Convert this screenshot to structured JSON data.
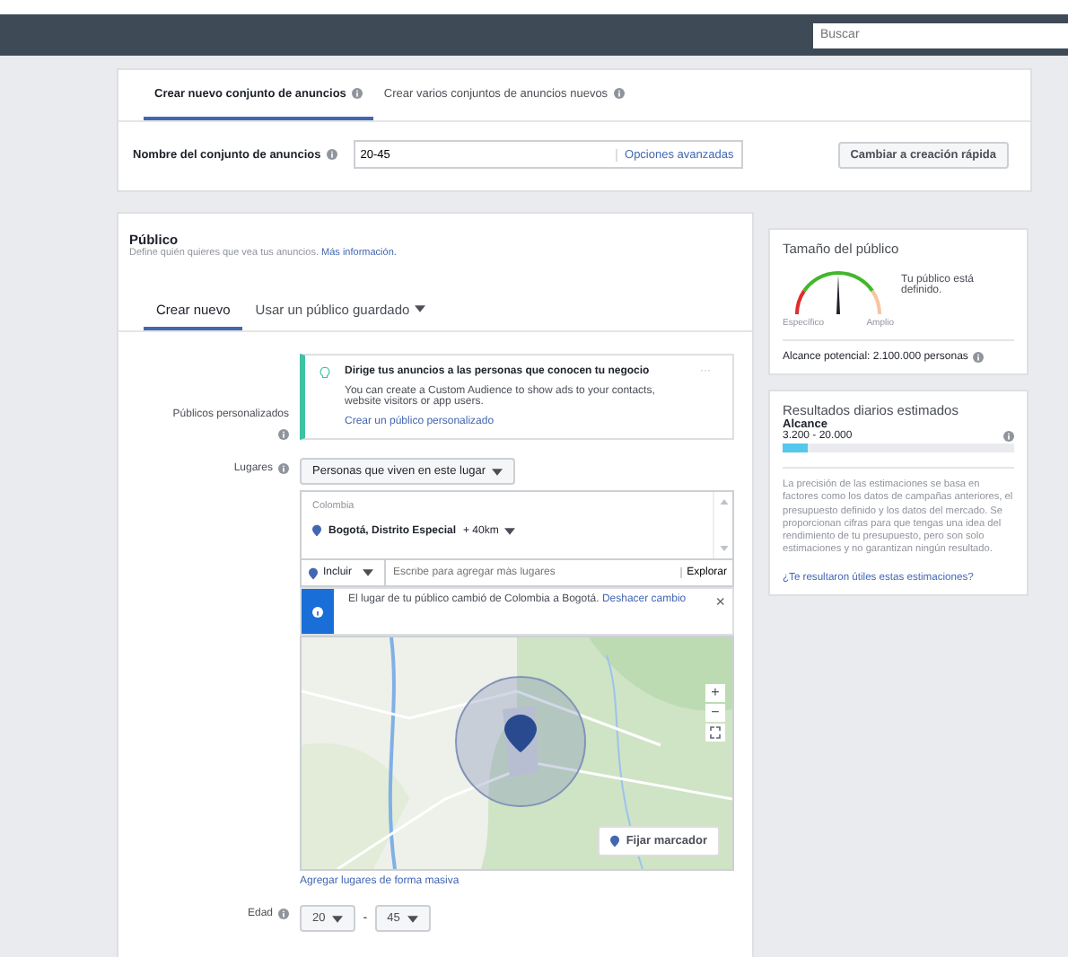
{
  "topbar": {
    "search": {
      "placeholder": "Buscar"
    }
  },
  "adset": {
    "tabs": [
      {
        "label": "Crear nuevo conjunto de anuncios",
        "selected": true
      },
      {
        "label": "Crear varios conjuntos de anuncios nuevos",
        "selected": false
      }
    ],
    "name_label": "Nombre del conjunto de anuncios",
    "name_value": "20-45",
    "advanced": "Opciones avanzadas",
    "quick_button": "Cambiar a creación rápida"
  },
  "audience": {
    "title": "Público",
    "subtitle": "Define quién quieres que vea tus anuncios.",
    "more_link": "Más información.",
    "tabs": [
      {
        "label": "Crear nuevo",
        "selected": true
      },
      {
        "label": "Usar un público guardado",
        "selected": false
      }
    ],
    "custom_label": "Públicos personalizados",
    "tip": {
      "title": "Dirige tus anuncios a las personas que conocen tu negocio",
      "more": "···",
      "body": "You can create a Custom Audience to show ads to your contacts, website visitors or app users.",
      "link": "Crear un público personalizado"
    },
    "places_label": "Lugares",
    "places_dropdown": "Personas que viven en este lugar",
    "country": "Colombia",
    "location": "Bogotá, Distrito Especial",
    "radius": "+ 40km",
    "include": "Incluir",
    "places_placeholder": "Escribe para agregar más lugares",
    "explore": "Explorar",
    "notice": {
      "text": "El lugar de tu público cambió de Colombia a Bogotá.",
      "undo": "Deshacer cambio",
      "close": "×"
    },
    "map": {
      "kind": "picture",
      "zoom_in": "+",
      "zoom_out": "−",
      "pin_button": "Fijar marcador"
    },
    "bulk_link": "Agregar lugares de forma masiva",
    "age_label": "Edad",
    "age_min": "20",
    "age_sep": "-",
    "age_max": "45"
  },
  "size": {
    "title": "Tamaño del público",
    "status": "Tu público está definido.",
    "specific": "Específico",
    "broad": "Amplio",
    "reach": "Alcance potencial: 2.100.000 personas"
  },
  "results": {
    "title": "Resultados diarios estimados",
    "metric": "Alcance",
    "range": "3.200 - 20.000",
    "level": 0.11,
    "note": "La precisión de las estimaciones se basa en factores como los datos de campañas anteriores, el presupuesto definido y los datos del mercado. Se proporcionan cifras para que tengas una idea del rendimiento de tu presupuesto, pero son solo estimaciones y no garantizan ningún resultado.",
    "feedback": "¿Te resultaron útiles estas estimaciones?"
  }
}
